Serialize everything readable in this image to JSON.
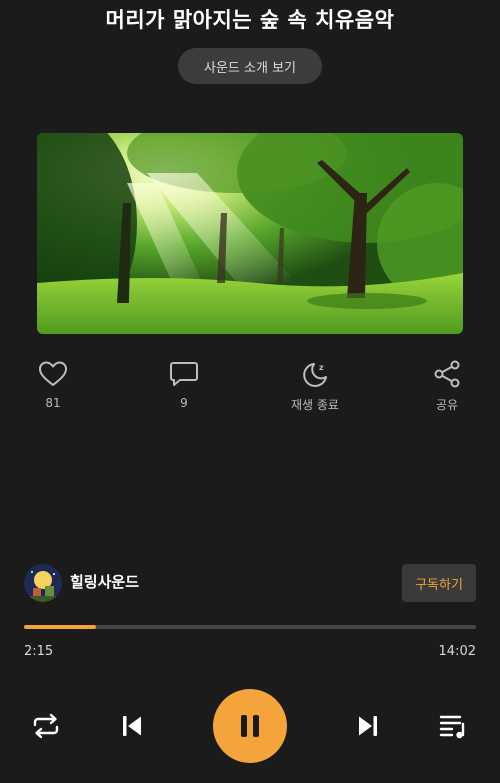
{
  "header": {
    "title": "머리가 맑아지는 숲 속 치유음악",
    "intro_button": "사운드 소개 보기"
  },
  "cover": {
    "icon": "forest-cover-image"
  },
  "actions": {
    "like": {
      "icon": "heart-icon",
      "label": "81"
    },
    "comment": {
      "icon": "comment-icon",
      "label": "9"
    },
    "sleep_timer": {
      "icon": "moon-sleep-icon",
      "label": "재생 종료"
    },
    "share": {
      "icon": "share-icon",
      "label": "공유"
    }
  },
  "channel": {
    "name": "힐링사운드",
    "subscribe_label": "구독하기"
  },
  "player": {
    "current_time": "2:15",
    "duration": "14:02",
    "progress_fraction": 0.16,
    "controls": [
      "repeat-icon",
      "previous-icon",
      "pause-icon",
      "next-icon",
      "playlist-icon"
    ]
  },
  "colors": {
    "background": "#1b1b1b",
    "accent": "#f5a33b",
    "subscribe_text": "#f0a23a"
  }
}
